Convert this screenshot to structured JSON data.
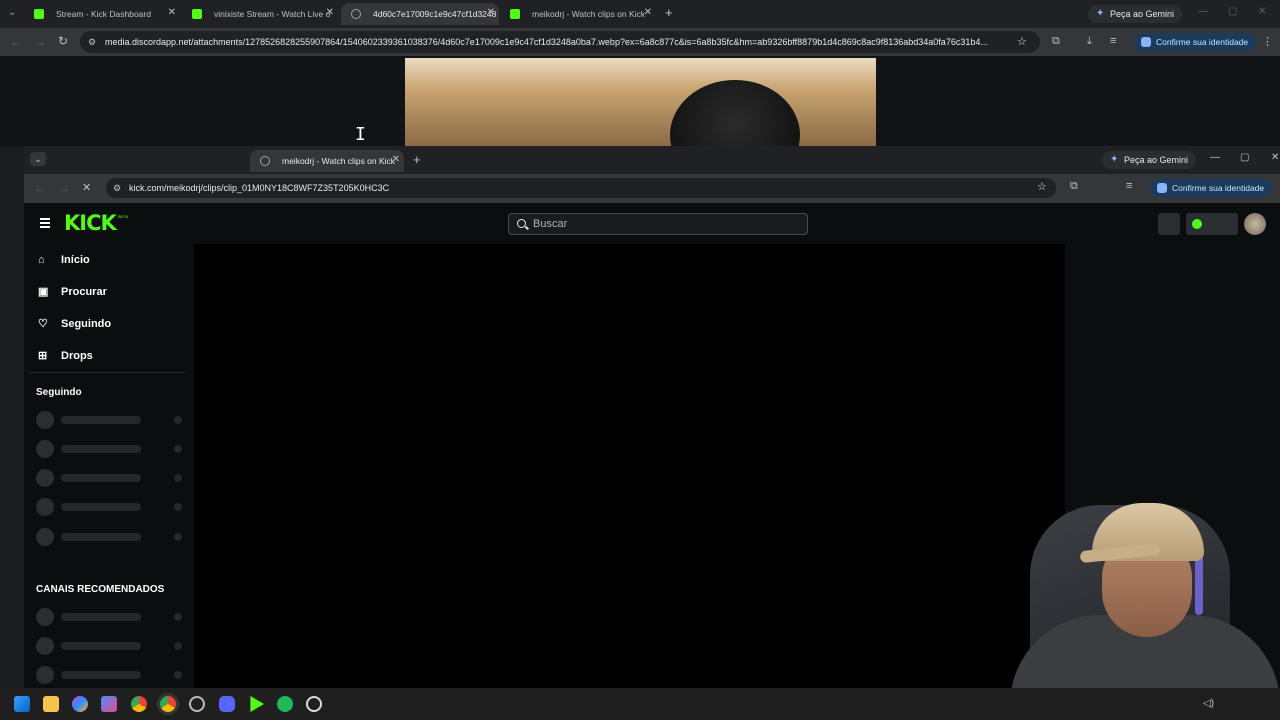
{
  "back_browser": {
    "tabs": [
      {
        "title": "Stream - Kick Dashboard"
      },
      {
        "title": "vinixiste Stream - Watch Live o"
      },
      {
        "title": "4d60c7e17009c1e9c47cf1d3248"
      },
      {
        "title": "meikodrj - Watch clips on Kick"
      }
    ],
    "url": "media.discordapp.net/attachments/1278526828255907864/1540602339361038376/4d60c7e17009c1e9c47cf1d3248a0ba7.webp?ex=6a8c877c&is=6a8b35fc&hm=ab9326bff8879b1d4c869c8ac9f8136abd34a0fa76c31b4...",
    "gemini": "Peça ao Gemini",
    "confirm": "Confirme sua identidade"
  },
  "front_browser": {
    "tab_title": "meikodrj - Watch clips on Kick",
    "url": "kick.com/meikodrj/clips/clip_01M0NY18C8WF7Z35T205K0HC3C",
    "gemini": "Peça ao Gemini",
    "confirm": "Confirme sua identidade"
  },
  "kick": {
    "logo": "KICK",
    "beta": "BETA",
    "search_placeholder": "Buscar",
    "nav": [
      {
        "label": "Início",
        "icon": "home-icon"
      },
      {
        "label": "Procurar",
        "icon": "browse-icon"
      },
      {
        "label": "Seguindo",
        "icon": "heart-icon"
      },
      {
        "label": "Drops",
        "icon": "drops-icon"
      }
    ],
    "following_title": "Seguindo",
    "recommended_title": "CANAIS RECOMENDADOS"
  },
  "colors": {
    "kick_green": "#53fc18",
    "chrome_dark": "#202124",
    "toolbar": "#35363a"
  }
}
